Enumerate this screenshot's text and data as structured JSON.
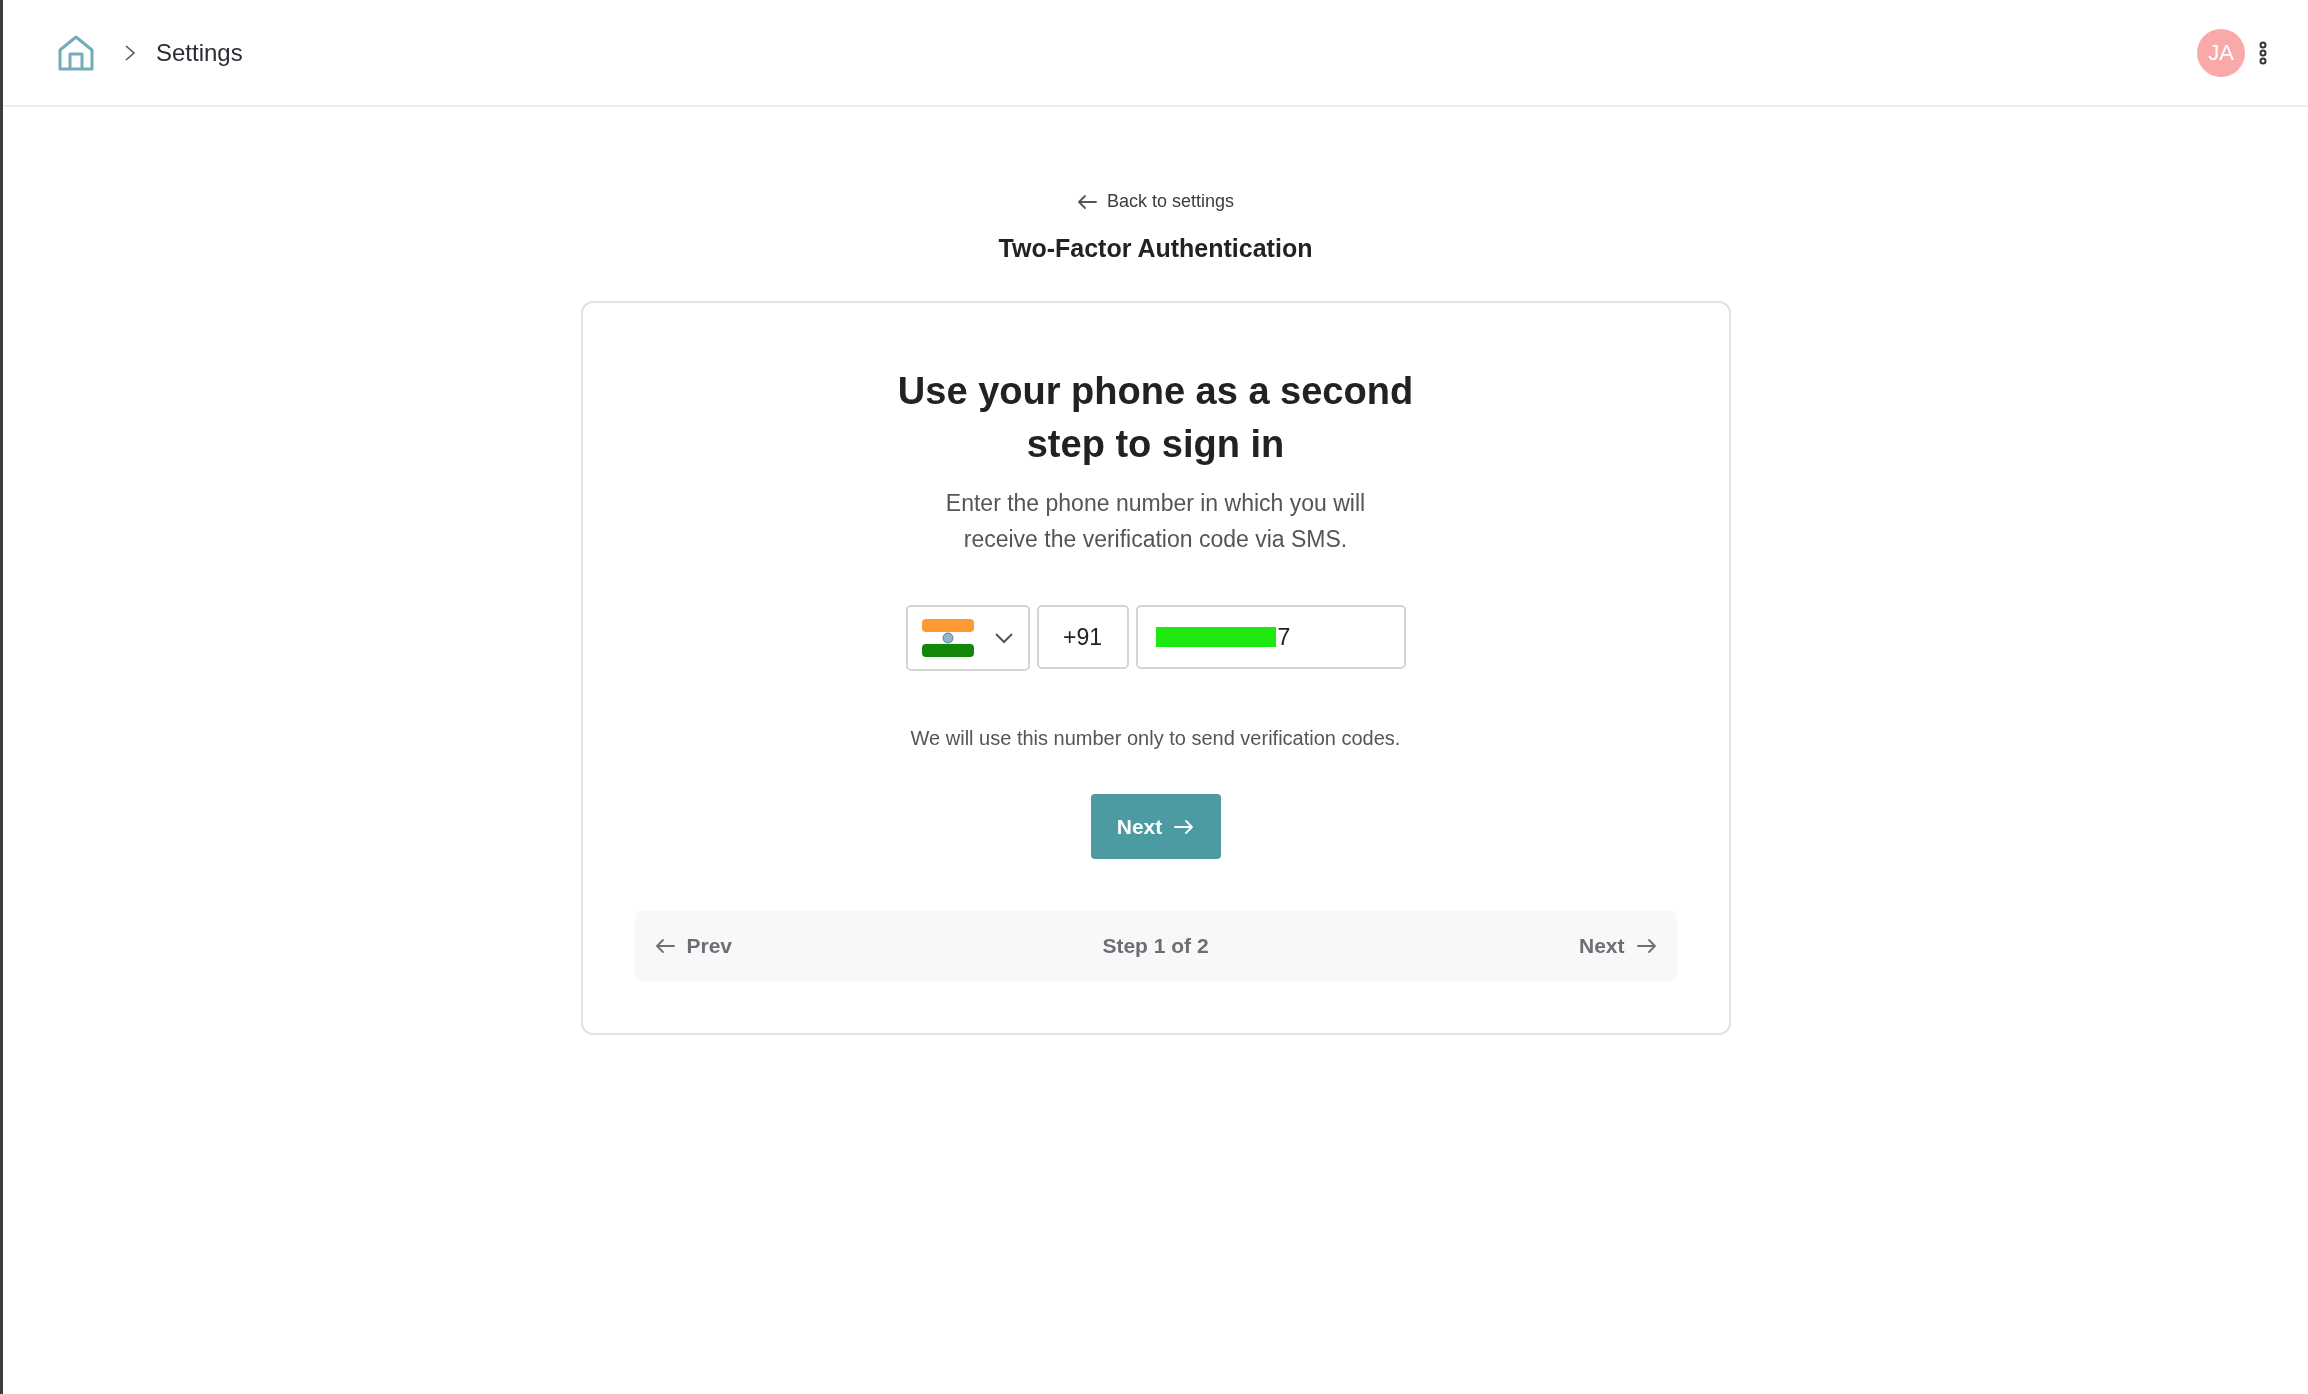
{
  "breadcrumb": {
    "current": "Settings"
  },
  "user": {
    "initials": "JA"
  },
  "back_link": "Back to settings",
  "page_title": "Two-Factor Authentication",
  "card": {
    "heading": "Use your phone as a second step to sign in",
    "description": "Enter the phone number in which you will receive the verification code via SMS.",
    "phone": {
      "country_code": "+91",
      "number": "7"
    },
    "note": "We will use this number only to send verification codes.",
    "next_button": "Next",
    "stepper": {
      "prev": "Prev",
      "step": "Step 1 of 2",
      "next": "Next"
    }
  }
}
